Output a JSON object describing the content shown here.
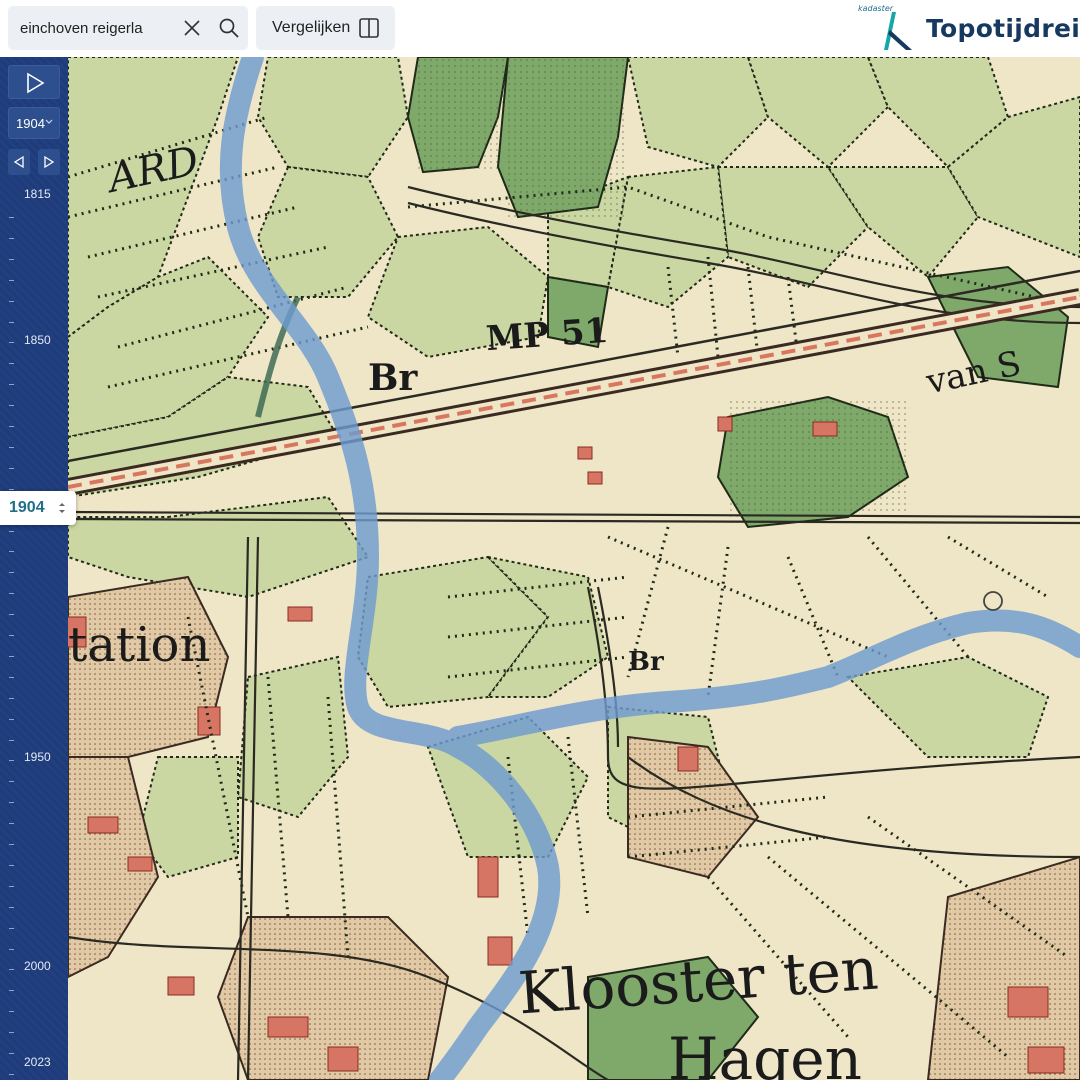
{
  "header": {
    "search": {
      "value": "einchoven reigerla",
      "placeholder": ""
    },
    "compare_label": "Vergelijken",
    "brand": {
      "small_text": "kadaster",
      "name": "Topotijdreis"
    }
  },
  "timeline": {
    "selected_year": "1904",
    "dropdown_value": "1904",
    "tick_labels": [
      {
        "label": "1815",
        "year": 1815
      },
      {
        "label": "1850",
        "year": 1850
      },
      {
        "label": "1950",
        "year": 1950
      },
      {
        "label": "2000",
        "year": 2000
      },
      {
        "label": "2023",
        "year": 2023
      }
    ]
  },
  "map": {
    "labels": [
      {
        "id": "label-arp",
        "text": "ARD"
      },
      {
        "id": "label-mp",
        "text": "MP 51"
      },
      {
        "id": "label-br",
        "text": "Br"
      },
      {
        "id": "label-van",
        "text": "van S"
      },
      {
        "id": "label-tation",
        "text": "tation"
      },
      {
        "id": "label-br2",
        "text": "Br"
      },
      {
        "id": "label-klooster",
        "text": "Klooster ten"
      },
      {
        "id": "label-hagen",
        "text": "Hagen"
      }
    ],
    "colors": {
      "paper": "#efe6c8",
      "meadow": "#c9d6a0",
      "forest": "#7fa96b",
      "built": "#d87a67",
      "route": "#6f9bd0",
      "railway": "#3a2a22"
    }
  }
}
